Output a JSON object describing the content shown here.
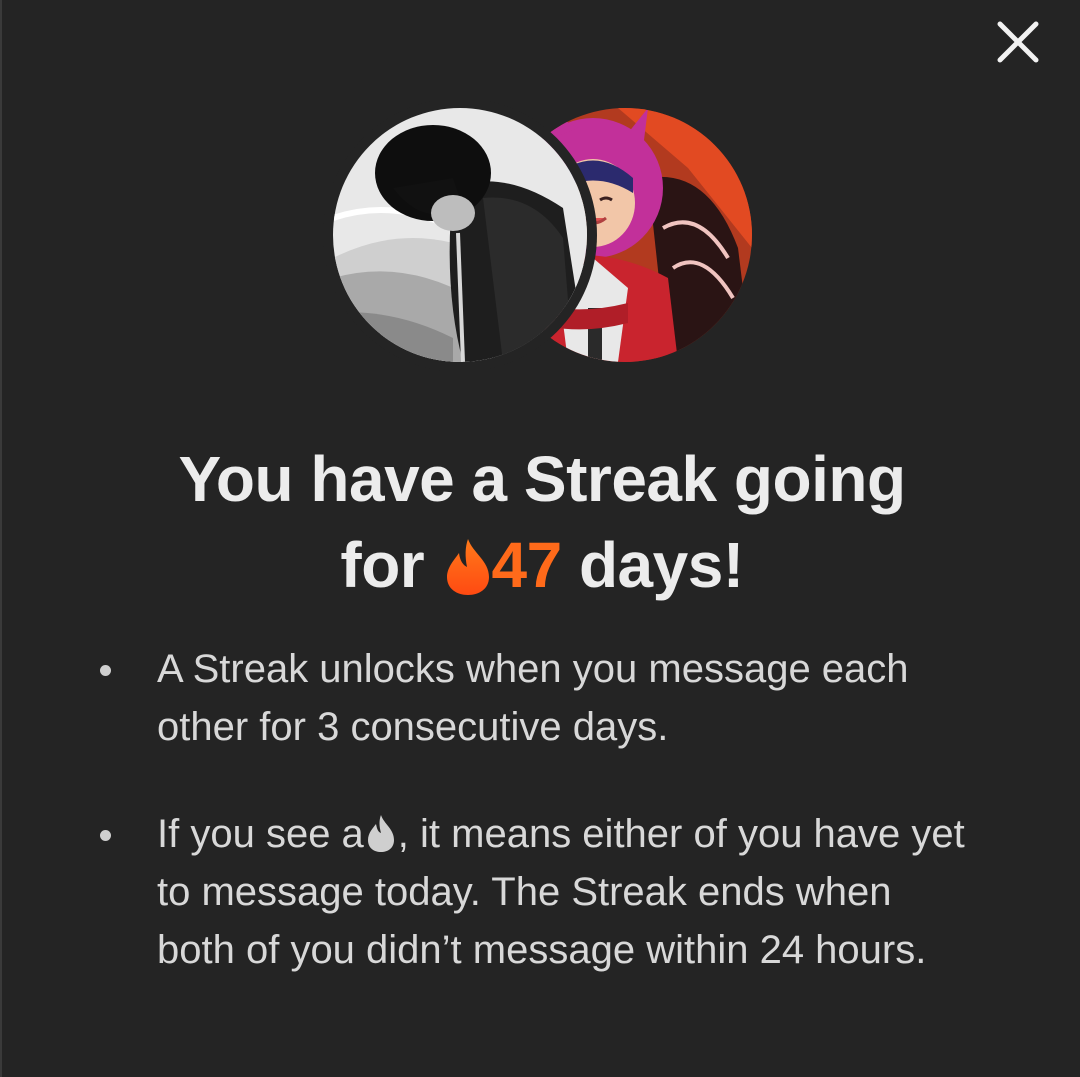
{
  "close_icon": "close-icon",
  "avatars": [
    {
      "name": "user-avatar",
      "style": "grayscale photo"
    },
    {
      "name": "match-avatar",
      "style": "anime illustration"
    }
  ],
  "headline": {
    "line1": "You have a Streak going",
    "for": "for",
    "count": "47",
    "days": "days!",
    "flame_icon": "flame-icon",
    "accent_color": "#ff6a1a"
  },
  "bullets": [
    {
      "text": "A Streak unlocks when you message each other for 3 consecutive days."
    },
    {
      "prefix": "If you see a",
      "icon": "gray-flame-icon",
      "suffix": ", it means either of you have yet to message today. The Streak ends when both of you didn’t message within 24 hours."
    }
  ]
}
